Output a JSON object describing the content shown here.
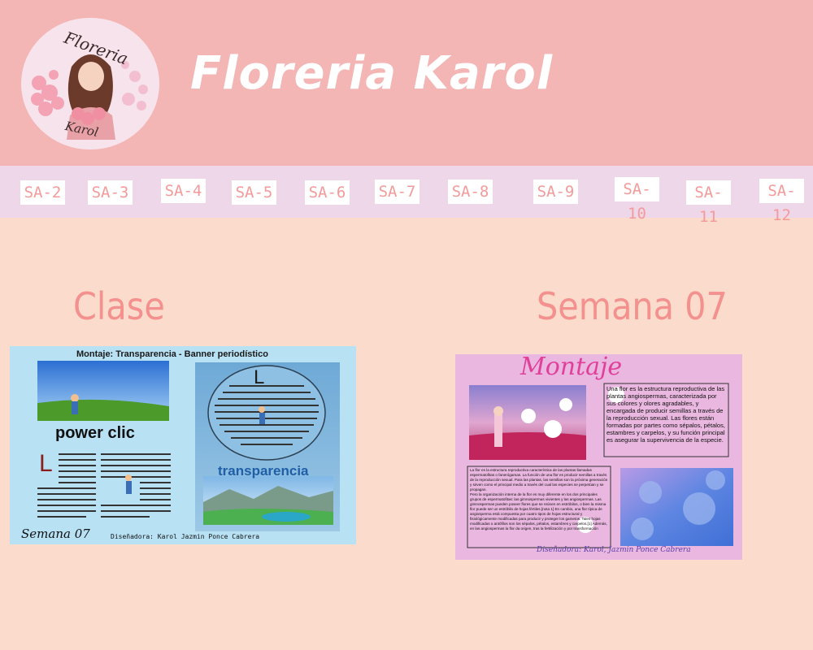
{
  "logo": {
    "script_text": "Floreria",
    "script_text_bottom": "Karol"
  },
  "header": {
    "title": "Floreria Karol"
  },
  "nav": {
    "items": [
      "SA-2",
      "SA-3",
      "SA-4",
      "SA-5",
      "SA-6",
      "SA-7",
      "SA-8",
      "SA-9",
      "SA-10",
      "SA-11",
      "SA-12"
    ]
  },
  "sections": {
    "left_label": "Clase",
    "right_label": "Semana 07"
  },
  "clase_banner": {
    "title": "Montaje: Transparencia - Banner periodístico",
    "power_text": "power clic",
    "transparency_text": "transparencia",
    "week_text": "Semana 07",
    "designer": "Diseñadora: Karol Jazmin Ponce Cabrera"
  },
  "montaje_card": {
    "title": "Montaje",
    "paragraph_1": "Una flor es la estructura reproductiva de las plantas angiospermas, caracterizada por sus colores y olores agradables, y encargada de producir semillas a través de la reproducción sexual. Las flores están formadas por partes como sépalos, pétalos, estambres y carpelos, y su función principal es asegurar la supervivencia de la especie.",
    "paragraph_2": "La flor es la estructura reproductiva característica de las plantas llamadas espermatofitas o fanerógamas. La función de una flor es producir semillas a través de la reproducción sexual. Para las plantas, las semillas son la próxima generación y sirven como el principal medio a través del cual las especies se perpetúan y se propagan.",
    "paragraph_3": "Pero la organización interna de la flor es muy diferente en los dos principales grupos de espermatofitas: las gimnospermas vivientes y las angiospermas. Las gimnospermas pueden poseer flores que se reúnen en estróbilos, o bien la misma flor puede ser un estróbilo de hojas fértiles.[nota 1] En cambio, una flor típica de angiosperma está compuesta por cuatro tipos de hojas estructural y fisiológicamente modificadas para producir y proteger los gametos. Tales hojas modificadas o antófilos son los sépalos, pétalos, estambres y carpelos.[1] Además, en las angiospermas la flor da origen, tras la fertilización y por transformación",
    "designer": "Diseñadora: Karol, Jazmin Ponce Cabrera"
  },
  "colors": {
    "header": "#f4b5b5",
    "nav": "#efd7ea",
    "page": "#fadbcc",
    "accent": "#f4918e"
  }
}
